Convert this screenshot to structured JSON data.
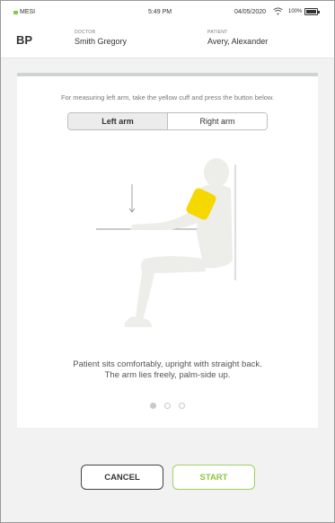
{
  "status_bar": {
    "brand": "MESI",
    "time": "5:49 PM",
    "date": "04/05/2020",
    "battery": "100%"
  },
  "header": {
    "title": "BP",
    "doctor_caption": "DOCTOR",
    "doctor_name": "Smith Gregory",
    "patient_caption": "PATIENT",
    "patient_name": "Avery, Alexander"
  },
  "card": {
    "instruction": "For measuring left arm, take the yellow cuff and press the button below.",
    "tabs": [
      {
        "label": "Left arm",
        "active": true
      },
      {
        "label": "Right arm",
        "active": false
      }
    ],
    "caption_line1": "Patient sits comfortably, upright with straight back.",
    "caption_line2": "The arm lies freely, palm-side up.",
    "pager": {
      "total": 3,
      "current": 1
    }
  },
  "buttons": {
    "cancel": "CANCEL",
    "start": "START"
  },
  "colors": {
    "accent_green": "#8cc63f",
    "cuff_yellow": "#f4d800",
    "figure_gray": "#ededea"
  }
}
